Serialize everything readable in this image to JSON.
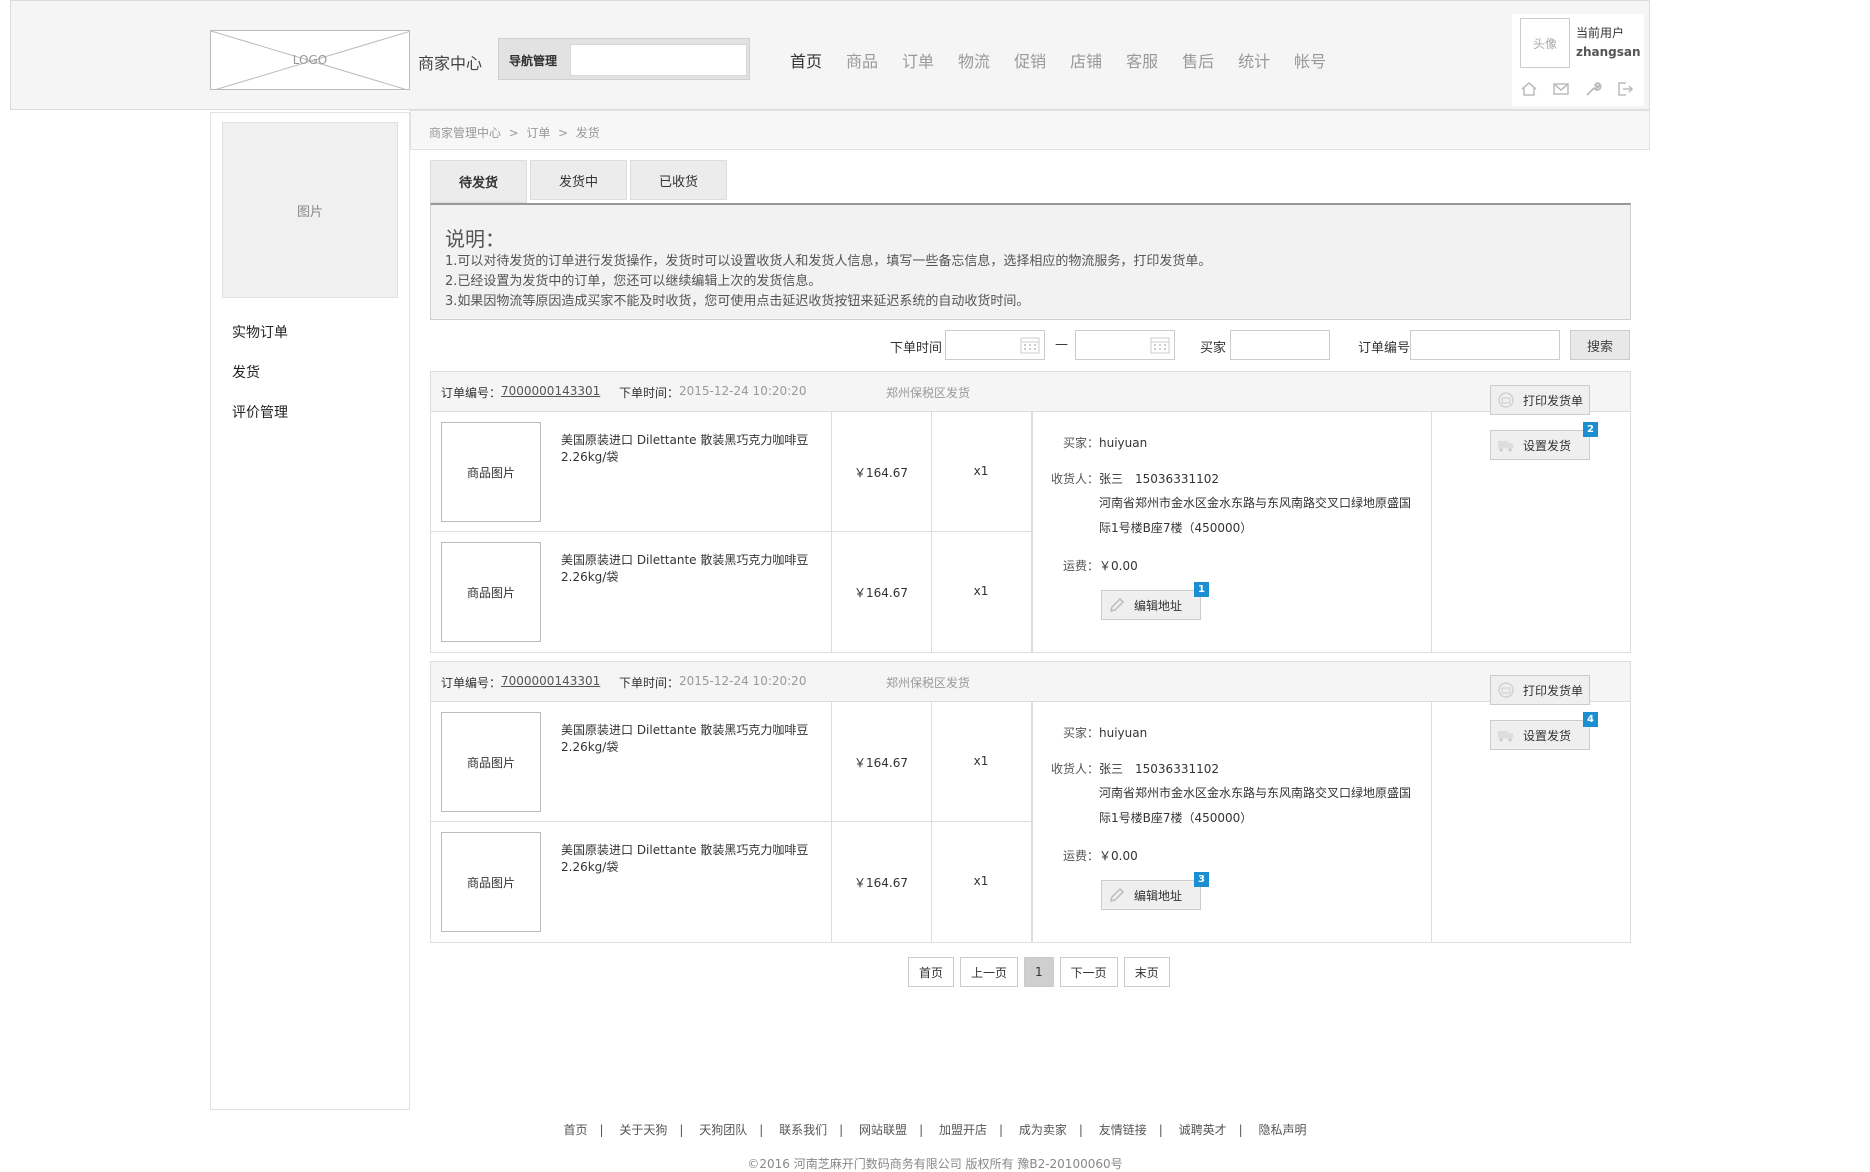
{
  "header": {
    "logo_text": "LOGO",
    "brand": "商家中心",
    "nav_manage_label": "导航管理",
    "nav": [
      "首页",
      "商品",
      "订单",
      "物流",
      "促销",
      "店铺",
      "客服",
      "售后",
      "统计",
      "帐号"
    ],
    "active_nav": "首页",
    "user": {
      "avatar_text": "头像",
      "label": "当前用户",
      "name": "zhangsan"
    },
    "user_icons": [
      "home-icon",
      "mail-icon",
      "wrench-icon",
      "logout-icon"
    ]
  },
  "sidebar": {
    "picture_label": "图片",
    "items": [
      "实物订单",
      "发货",
      "评价管理"
    ]
  },
  "breadcrumb": {
    "root": "商家管理中心",
    "level1": "订单",
    "level2": "发货",
    "sep": ">"
  },
  "tabs": [
    {
      "label": "待发货",
      "active": true
    },
    {
      "label": "发货中",
      "active": false
    },
    {
      "label": "已收货",
      "active": false
    }
  ],
  "notice": {
    "title": "说明：",
    "lines": [
      "1.可以对待发货的订单进行发货操作，发货时可以设置收货人和发货人信息，填写一些备忘信息，选择相应的物流服务，打印发货单。",
      "2.已经设置为发货中的订单，您还可以继续编辑上次的发货信息。",
      "3.如果因物流等原因造成买家不能及时收货，您可使用点击延迟收货按钮来延迟系统的自动收货时间。"
    ]
  },
  "filter": {
    "order_time_label": "下单时间",
    "dash": "—",
    "buyer_label": "买家",
    "order_no_label": "订单编号",
    "search_button": "搜索"
  },
  "orders": [
    {
      "order_no_label": "订单编号：",
      "order_no": "7000000143301",
      "time_label": "下单时间：",
      "time": "2015-12-24 10:20:20",
      "warehouse": "郑州保税区发货",
      "products": [
        {
          "image_label": "商品图片",
          "name": "美国原装进口 Dilettante 散装黑巧克力咖啡豆 2.26kg/袋",
          "price": "￥164.67",
          "qty": "x1"
        },
        {
          "image_label": "商品图片",
          "name": "美国原装进口 Dilettante 散装黑巧克力咖啡豆 2.26kg/袋",
          "price": "￥164.67",
          "qty": "x1"
        }
      ],
      "buyer_label": "买家：",
      "buyer": "huiyuan",
      "receiver_label": "收货人：",
      "receiver": "张三　15036331102",
      "address_line1": "河南省郑州市金水区金水东路与东风南路交叉口绿地原盛国",
      "address_line2": "际1号楼B座7楼（450000）",
      "freight_label": "运费：",
      "freight": "￥0.00",
      "edit_address_button": "编辑地址",
      "edit_badge": "1",
      "print_button": "打印发货单",
      "ship_button": "设置发货",
      "ship_badge": "2"
    },
    {
      "order_no_label": "订单编号：",
      "order_no": "7000000143301",
      "time_label": "下单时间：",
      "time": "2015-12-24 10:20:20",
      "warehouse": "郑州保税区发货",
      "products": [
        {
          "image_label": "商品图片",
          "name": "美国原装进口 Dilettante 散装黑巧克力咖啡豆 2.26kg/袋",
          "price": "￥164.67",
          "qty": "x1"
        },
        {
          "image_label": "商品图片",
          "name": "美国原装进口 Dilettante 散装黑巧克力咖啡豆 2.26kg/袋",
          "price": "￥164.67",
          "qty": "x1"
        }
      ],
      "buyer_label": "买家：",
      "buyer": "huiyuan",
      "receiver_label": "收货人：",
      "receiver": "张三　15036331102",
      "address_line1": "河南省郑州市金水区金水东路与东风南路交叉口绿地原盛国",
      "address_line2": "际1号楼B座7楼（450000）",
      "freight_label": "运费：",
      "freight": "￥0.00",
      "edit_address_button": "编辑地址",
      "edit_badge": "3",
      "print_button": "打印发货单",
      "ship_button": "设置发货",
      "ship_badge": "4"
    }
  ],
  "pagination": {
    "first": "首页",
    "prev": "上一页",
    "current": "1",
    "next": "下一页",
    "last": "末页"
  },
  "footer": {
    "links": [
      "首页",
      "关于天狗",
      "天狗团队",
      "联系我们",
      "网站联盟",
      "加盟开店",
      "成为卖家",
      "友情链接",
      "诚聘英才",
      "隐私声明"
    ],
    "separator": "|",
    "copyright": "©2016 河南芝麻开门数码商务有限公司 版权所有 豫B2-20100060号"
  },
  "colors": {
    "badge": "#1b8fd1",
    "header_bg": "#f5f5f5"
  }
}
